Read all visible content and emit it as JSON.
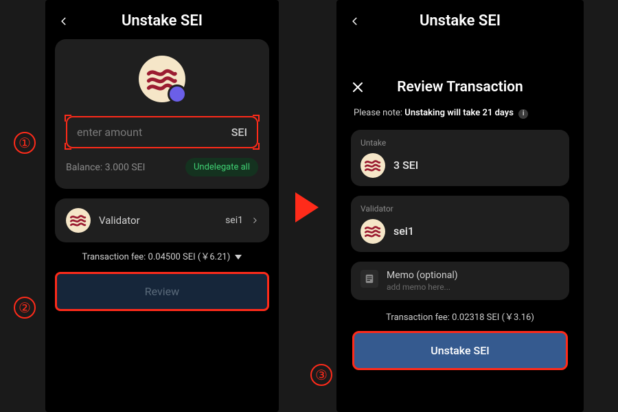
{
  "left": {
    "title": "Unstake SEI",
    "amount_placeholder": "enter amount",
    "amount_unit": "SEI",
    "balance_label": "Balance: 3.000 SEI",
    "undelegate_all": "Undelegate all",
    "validator_label": "Validator",
    "validator_value": "sei1",
    "tx_fee": "Transaction fee: 0.04500 SEI (￥6.21)",
    "review": "Review"
  },
  "right": {
    "title": "Unstake SEI",
    "sheet_title": "Review Transaction",
    "note_prefix": "Please note: ",
    "note_bold": "Unstaking will take 21 days",
    "untake_label": "Untake",
    "untake_value": "3 SEI",
    "validator_label": "Validator",
    "validator_value": "sei1",
    "memo_label": "Memo (optional)",
    "memo_placeholder": "add memo here...",
    "tx_fee": "Transaction fee: 0.02318 SEI (￥3.16)",
    "cta": "Unstake SEI"
  },
  "annotations": {
    "step1": "①",
    "step2": "②",
    "step3": "③"
  }
}
